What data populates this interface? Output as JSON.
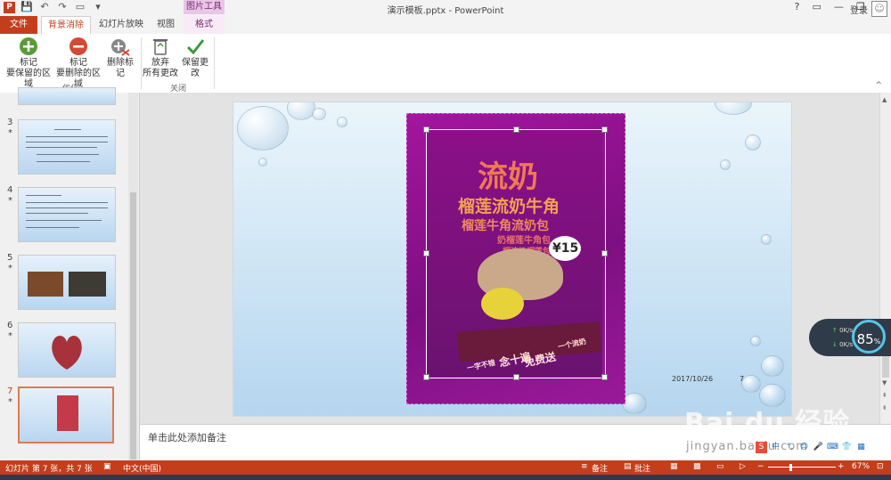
{
  "window": {
    "title": "演示模板.pptx - PowerPoint",
    "context_header": "图片工具",
    "controls": [
      "?",
      "▭",
      "—",
      "❐",
      "✕"
    ],
    "login": "登录"
  },
  "tabs": {
    "file": "文件",
    "background_removal": "背景消除",
    "slideshow": "幻灯片放映",
    "view": "视图",
    "format": "格式"
  },
  "ribbon": {
    "mark_keep_line1": "标记",
    "mark_keep_line2": "要保留的区域",
    "mark_remove_line1": "标记",
    "mark_remove_line2": "要删除的区域",
    "delete_mark": "删除标记",
    "discard_line1": "放弃",
    "discard_line2": "所有更改",
    "keep_changes": "保留更改",
    "group_optimize": "优化",
    "group_close": "关闭",
    "collapse": "^"
  },
  "slides": [
    {
      "num": "3",
      "star": "*"
    },
    {
      "num": "4",
      "star": "*"
    },
    {
      "num": "5",
      "star": "*"
    },
    {
      "num": "6",
      "star": "*"
    },
    {
      "num": "7",
      "star": "*"
    }
  ],
  "poster": {
    "headline": "流奶",
    "line2": "榴莲流奶牛角",
    "line3": "榴莲牛角流奶包",
    "line4": "奶榴莲牛角包",
    "line5": "榴流奶榴莲包",
    "price": "¥15",
    "slogan_left": "一字不错",
    "slogan_mid": "念十遍",
    "slogan_right": "免费送",
    "slogan_end": "一个流奶"
  },
  "slide_footer": {
    "date": "2017/10/26",
    "page": "7"
  },
  "notes_placeholder": "单击此处添加备注",
  "status": {
    "slide_info": "幻灯片 第 7 张，共 7 张",
    "language": "中文(中国)",
    "notes": "备注",
    "comments": "批注",
    "zoom": "67%"
  },
  "speed_widget": {
    "up": "0K/s",
    "down": "0K/s",
    "percent": "85",
    "unit": "%"
  },
  "watermark": {
    "brand": "Bai du 经验",
    "url": "jingyan.baidu.com"
  },
  "colors": {
    "accent": "#c43e1c",
    "picture_tools": "#e9c6e6",
    "poster_magenta": "#9a1a9a"
  }
}
